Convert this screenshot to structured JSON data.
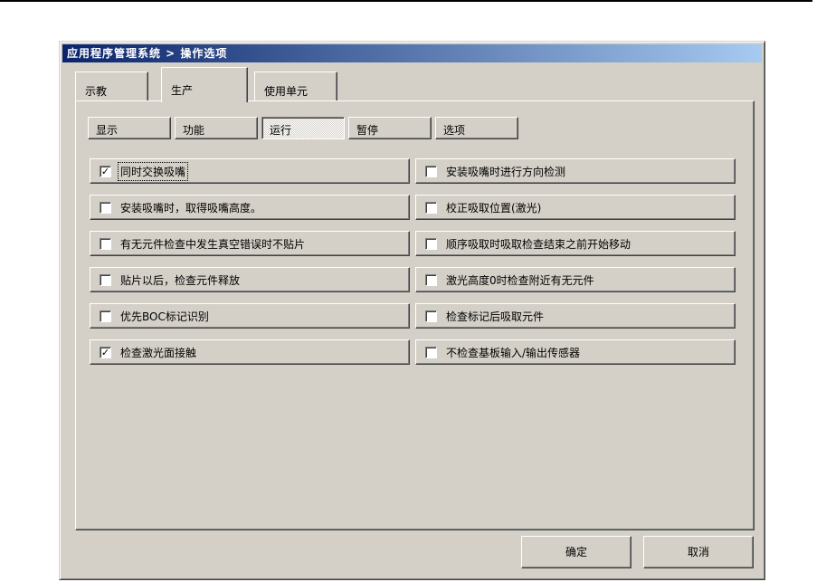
{
  "window": {
    "title": "应用程序管理系统 > 操作选项",
    "main_tabs": [
      {
        "label": "示教",
        "active": false
      },
      {
        "label": "生产",
        "active": true
      },
      {
        "label": "使用单元",
        "active": false
      }
    ],
    "sub_tabs": [
      {
        "label": "显示",
        "active": false
      },
      {
        "label": "功能",
        "active": false
      },
      {
        "label": "运行",
        "active": true
      },
      {
        "label": "暂停",
        "active": false
      },
      {
        "label": "选项",
        "active": false
      }
    ],
    "options_left": [
      {
        "label": "同时交换吸嘴",
        "checked": true,
        "focused": true
      },
      {
        "label": "安装吸嘴时，取得吸嘴高度。",
        "checked": false
      },
      {
        "label": "有无元件检查中发生真空错误时不贴片",
        "checked": false
      },
      {
        "label": "贴片以后，检查元件释放",
        "checked": false
      },
      {
        "label": "优先BOC标记识别",
        "checked": false
      },
      {
        "label": "检查激光面接触",
        "checked": true
      }
    ],
    "options_right": [
      {
        "label": "安装吸嘴时进行方向检测",
        "checked": false
      },
      {
        "label": "校正吸取位置(激光)",
        "checked": false
      },
      {
        "label": "顺序吸取时吸取检查结束之前开始移动",
        "checked": false
      },
      {
        "label": "激光高度0时检查附近有无元件",
        "checked": false
      },
      {
        "label": "检查标记后吸取元件",
        "checked": false
      },
      {
        "label": "不检查基板输入/输出传感器",
        "checked": false
      }
    ],
    "footer": {
      "ok_label": "确定",
      "cancel_label": "取消"
    },
    "colors": {
      "titlebar_left": "#0a246a",
      "titlebar_right": "#a6caf0",
      "dialog_bg": "#d4d0c8",
      "title_text": "#ffffff"
    }
  }
}
